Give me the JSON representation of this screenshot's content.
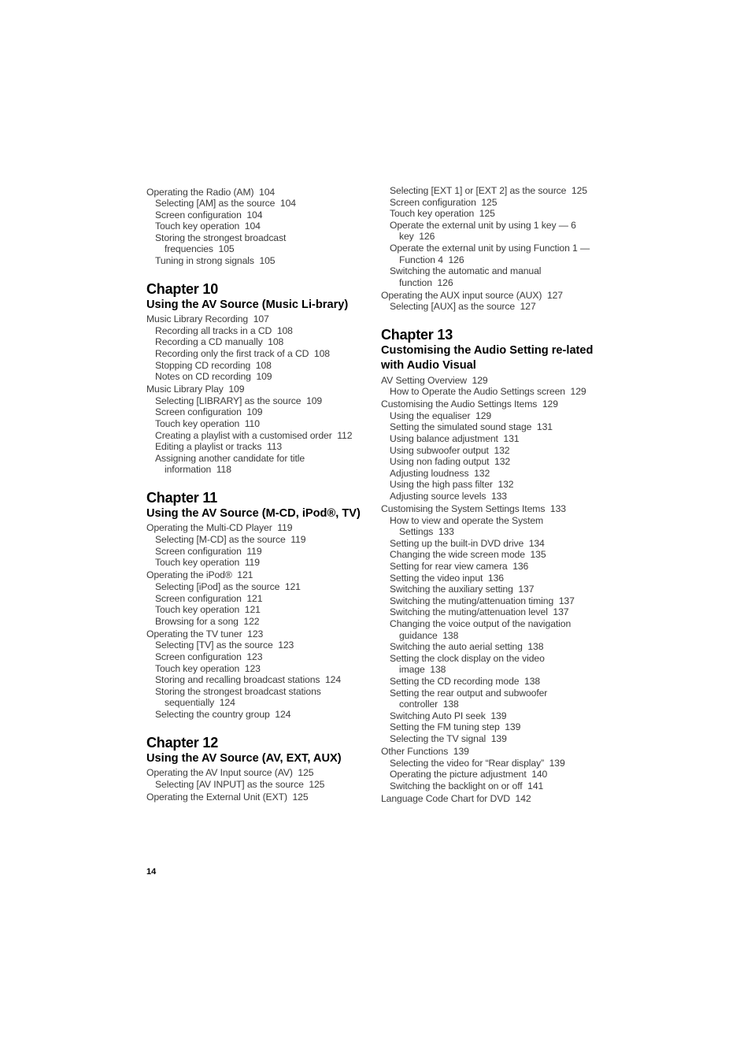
{
  "page_number": "14",
  "left_column": {
    "pre_entries": [
      {
        "level": 1,
        "text": "Operating the Radio (AM)",
        "page": "104"
      },
      {
        "level": 2,
        "text": "Selecting [AM] as the source",
        "page": "104"
      },
      {
        "level": 2,
        "text": "Screen configuration",
        "page": "104"
      },
      {
        "level": 2,
        "text": "Touch key operation",
        "page": "104"
      },
      {
        "level": 2,
        "text": "Storing the strongest broadcast",
        "cont": "frequencies",
        "page": "105"
      },
      {
        "level": 2,
        "text": "Tuning in strong signals",
        "page": "105"
      }
    ],
    "chapters": [
      {
        "label": "Chapter  10",
        "title": "Using the AV Source (Music Li-brary)",
        "entries": [
          {
            "level": 1,
            "text": "Music Library Recording",
            "page": "107"
          },
          {
            "level": 2,
            "text": "Recording all tracks in a CD",
            "page": "108"
          },
          {
            "level": 2,
            "text": "Recording a CD manually",
            "page": "108"
          },
          {
            "level": 2,
            "text": "Recording only the first track of a CD",
            "page": "108"
          },
          {
            "level": 2,
            "text": "Stopping CD recording",
            "page": "108"
          },
          {
            "level": 2,
            "text": "Notes on CD recording",
            "page": "109"
          },
          {
            "level": 1,
            "text": "Music Library Play",
            "page": "109"
          },
          {
            "level": 2,
            "text": "Selecting [LIBRARY] as the source",
            "page": "109"
          },
          {
            "level": 2,
            "text": "Screen configuration",
            "page": "109"
          },
          {
            "level": 2,
            "text": "Touch key operation",
            "page": "110"
          },
          {
            "level": 2,
            "text": "Creating a playlist with a customised order",
            "page": "112"
          },
          {
            "level": 2,
            "text": "Editing a playlist or tracks",
            "page": "113"
          },
          {
            "level": 2,
            "text": "Assigning another candidate for title",
            "cont": "information",
            "page": "118"
          }
        ]
      },
      {
        "label": "Chapter  11",
        "title": "Using the AV Source (M-CD, iPod®, TV)",
        "entries": [
          {
            "level": 1,
            "text": "Operating the Multi-CD Player",
            "page": "119"
          },
          {
            "level": 2,
            "text": "Selecting [M-CD] as the source",
            "page": "119"
          },
          {
            "level": 2,
            "text": "Screen configuration",
            "page": "119"
          },
          {
            "level": 2,
            "text": "Touch key operation",
            "page": "119"
          },
          {
            "level": 1,
            "text": "Operating the iPod®",
            "page": "121"
          },
          {
            "level": 2,
            "text": "Selecting [iPod] as the source",
            "page": "121"
          },
          {
            "level": 2,
            "text": "Screen configuration",
            "page": "121"
          },
          {
            "level": 2,
            "text": "Touch key operation",
            "page": "121"
          },
          {
            "level": 2,
            "text": "Browsing for a song",
            "page": "122"
          },
          {
            "level": 1,
            "text": "Operating the TV tuner",
            "page": "123"
          },
          {
            "level": 2,
            "text": "Selecting [TV] as the source",
            "page": "123"
          },
          {
            "level": 2,
            "text": "Screen configuration",
            "page": "123"
          },
          {
            "level": 2,
            "text": "Touch key operation",
            "page": "123"
          },
          {
            "level": 2,
            "text": "Storing and recalling broadcast stations",
            "page": "124"
          },
          {
            "level": 2,
            "text": "Storing the strongest broadcast stations",
            "cont": "sequentially",
            "page": "124"
          },
          {
            "level": 2,
            "text": "Selecting the country group",
            "page": "124"
          }
        ]
      },
      {
        "label": "Chapter  12",
        "title": "Using the AV Source (AV, EXT, AUX)",
        "entries": [
          {
            "level": 1,
            "text": "Operating the AV Input source (AV)",
            "page": "125"
          },
          {
            "level": 2,
            "text": "Selecting [AV INPUT] as the source",
            "page": "125"
          },
          {
            "level": 1,
            "text": "Operating the External Unit (EXT)",
            "page": "125"
          }
        ]
      }
    ]
  },
  "right_column": {
    "pre_entries": [
      {
        "level": 2,
        "text": "Selecting [EXT 1] or [EXT 2] as the source",
        "page": "125"
      },
      {
        "level": 2,
        "text": "Screen configuration",
        "page": "125"
      },
      {
        "level": 2,
        "text": "Touch key operation",
        "page": "125"
      },
      {
        "level": 2,
        "text": "Operate the external unit by using 1 key — 6",
        "cont": "key",
        "page": "126"
      },
      {
        "level": 2,
        "text": "Operate the external unit by using Function 1 —",
        "cont": "Function 4",
        "page": "126"
      },
      {
        "level": 2,
        "text": "Switching the automatic and manual",
        "cont": "function",
        "page": "126"
      },
      {
        "level": 1,
        "text": "Operating the AUX input source (AUX)",
        "page": "127"
      },
      {
        "level": 2,
        "text": "Selecting [AUX] as the source",
        "page": "127"
      }
    ],
    "chapters": [
      {
        "label": "Chapter  13",
        "title": "Customising the Audio Setting re-lated with Audio Visual",
        "entries": [
          {
            "level": 1,
            "text": "AV Setting Overview",
            "page": "129"
          },
          {
            "level": 2,
            "text": "How to Operate the Audio Settings screen",
            "page": "129"
          },
          {
            "level": 1,
            "text": "Customising the Audio Settings Items",
            "page": "129"
          },
          {
            "level": 2,
            "text": "Using the equaliser",
            "page": "129"
          },
          {
            "level": 2,
            "text": "Setting the simulated sound stage",
            "page": "131"
          },
          {
            "level": 2,
            "text": "Using balance adjustment",
            "page": "131"
          },
          {
            "level": 2,
            "text": "Using subwoofer output",
            "page": "132"
          },
          {
            "level": 2,
            "text": "Using non fading output",
            "page": "132"
          },
          {
            "level": 2,
            "text": "Adjusting loudness",
            "page": "132"
          },
          {
            "level": 2,
            "text": "Using the high pass filter",
            "page": "132"
          },
          {
            "level": 2,
            "text": "Adjusting source levels",
            "page": "133"
          },
          {
            "level": 1,
            "text": "Customising the System Settings Items",
            "page": "133"
          },
          {
            "level": 2,
            "text": "How to view and operate the System",
            "cont": "Settings",
            "page": "133"
          },
          {
            "level": 2,
            "text": "Setting up the built-in DVD drive",
            "page": "134"
          },
          {
            "level": 2,
            "text": "Changing the wide screen mode",
            "page": "135"
          },
          {
            "level": 2,
            "text": "Setting for rear view camera",
            "page": "136"
          },
          {
            "level": 2,
            "text": "Setting the video input",
            "page": "136"
          },
          {
            "level": 2,
            "text": "Switching the auxiliary setting",
            "page": "137"
          },
          {
            "level": 2,
            "text": "Switching the muting/attenuation timing",
            "page": "137"
          },
          {
            "level": 2,
            "text": "Switching the muting/attenuation level",
            "page": "137"
          },
          {
            "level": 2,
            "text": "Changing the voice output of the navigation",
            "cont": "guidance",
            "page": "138"
          },
          {
            "level": 2,
            "text": "Switching the auto aerial setting",
            "page": "138"
          },
          {
            "level": 2,
            "text": "Setting the clock display on the video",
            "cont": "image",
            "page": "138"
          },
          {
            "level": 2,
            "text": "Setting the CD recording mode",
            "page": "138"
          },
          {
            "level": 2,
            "text": "Setting the rear output and subwoofer",
            "cont": "controller",
            "page": "138"
          },
          {
            "level": 2,
            "text": "Switching Auto PI seek",
            "page": "139"
          },
          {
            "level": 2,
            "text": "Setting the FM tuning step",
            "page": "139"
          },
          {
            "level": 2,
            "text": "Selecting the TV signal",
            "page": "139"
          },
          {
            "level": 1,
            "text": "Other Functions",
            "page": "139"
          },
          {
            "level": 2,
            "text": "Selecting the video for “Rear display”",
            "page": "139"
          },
          {
            "level": 2,
            "text": "Operating the picture adjustment",
            "page": "140"
          },
          {
            "level": 2,
            "text": "Switching the backlight on or off",
            "page": "141"
          },
          {
            "level": 1,
            "text": "Language Code Chart for DVD",
            "page": "142"
          }
        ]
      }
    ]
  }
}
